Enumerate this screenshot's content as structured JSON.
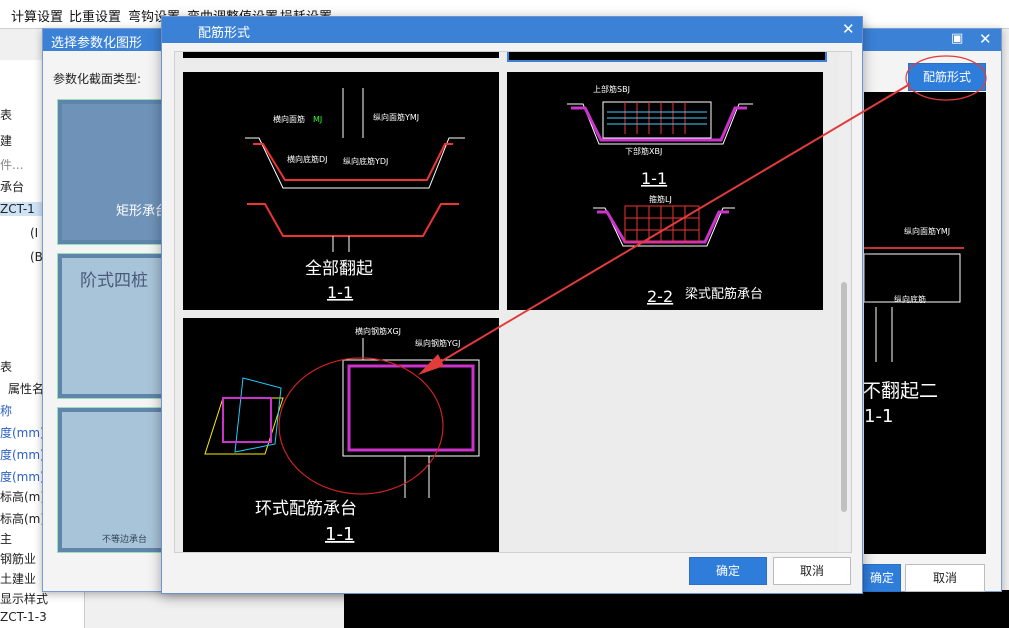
{
  "menu": [
    "计算设置",
    "比重设置",
    "弯钩设置",
    "弯曲调整值设置",
    "损耗设置"
  ],
  "left_panel": {
    "items": [
      "表",
      "建",
      "件...",
      "承台",
      "ZCT-1",
      "(I",
      "(B",
      "表",
      "属性名",
      "称",
      "度(mm)",
      "度(mm)",
      "度(mm)",
      "标高(m)",
      "标高(m)",
      "主",
      "钢筋业",
      "土建业",
      "显示样式",
      "ZCT-1-3"
    ]
  },
  "bg_dialog": {
    "title": "选择参数化图形",
    "section_label": "参数化截面类型:",
    "thumbs": [
      "矩形承台",
      "阶式四桩",
      "不等边承台"
    ],
    "rebar_button": "配筋形式",
    "ok": "确定",
    "cancel": "取消",
    "preview_texts": [
      "不翻起二",
      "1-1"
    ]
  },
  "dialog": {
    "title": "配筋形式",
    "ok": "确定",
    "cancel": "取消",
    "options": [
      {
        "caption": "全部翻起",
        "section": "1-1"
      },
      {
        "caption": "梁式配筋承台",
        "section": "1-1",
        "section2": "2-2"
      },
      {
        "caption": "环式配筋承台",
        "section": "1-1"
      }
    ]
  },
  "colors": {
    "accent": "#3b82d7",
    "annotation_red": "#e23b3b"
  }
}
